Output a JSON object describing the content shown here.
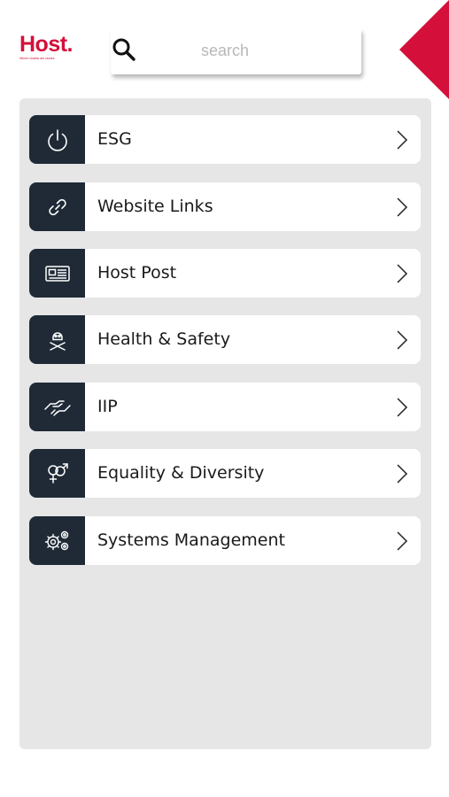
{
  "header": {
    "logo_text": "Host.",
    "logo_tagline": "Where closets are stories",
    "search_placeholder": "search"
  },
  "menu": {
    "items": [
      {
        "label": "ESG",
        "icon": "power-icon"
      },
      {
        "label": "Website Links",
        "icon": "link-icon"
      },
      {
        "label": "Host Post",
        "icon": "newspaper-icon"
      },
      {
        "label": "Health & Safety",
        "icon": "skull-crossbones-icon"
      },
      {
        "label": "IIP",
        "icon": "handshake-icon"
      },
      {
        "label": "Equality & Diversity",
        "icon": "gender-symbols-icon"
      },
      {
        "label": "Systems Management",
        "icon": "gears-icon"
      }
    ]
  },
  "colors": {
    "brand": "#d4103a",
    "icon_background": "#1f2a36",
    "panel_background": "#e6e6e6"
  }
}
